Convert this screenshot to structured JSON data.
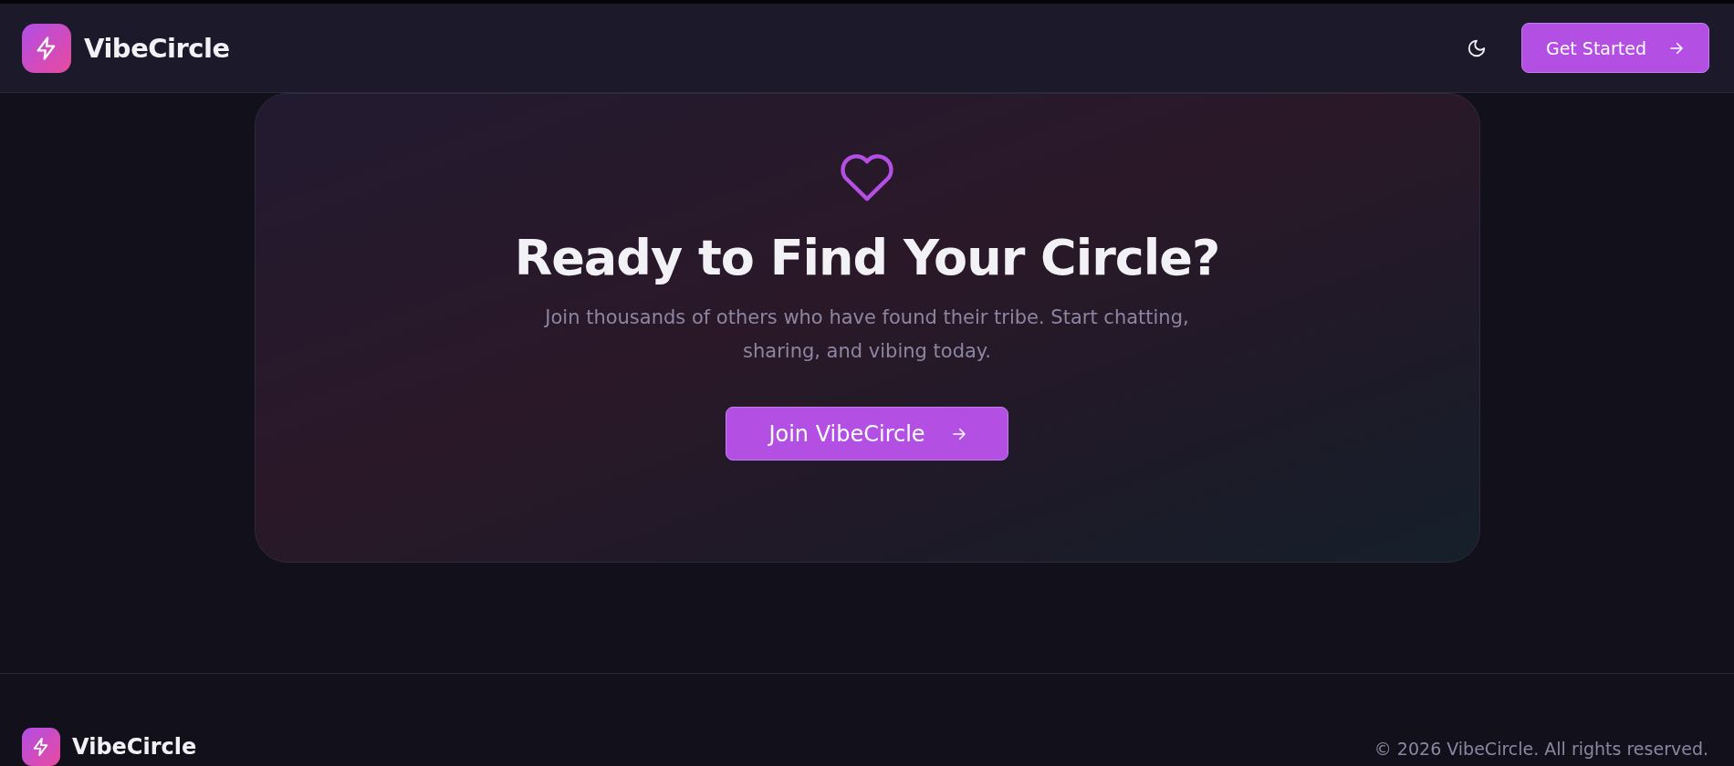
{
  "header": {
    "brand": "VibeCircle",
    "cta": {
      "label": "Get Started"
    }
  },
  "cta_card": {
    "title": "Ready to Find Your Circle?",
    "text": "Join thousands of others who have found their tribe. Start chatting, sharing, and vibing today.",
    "button": {
      "label": "Join VibeCircle"
    }
  },
  "footer": {
    "brand": "VibeCircle",
    "copyright": "© 2026 VibeCircle. All rights reserved."
  }
}
